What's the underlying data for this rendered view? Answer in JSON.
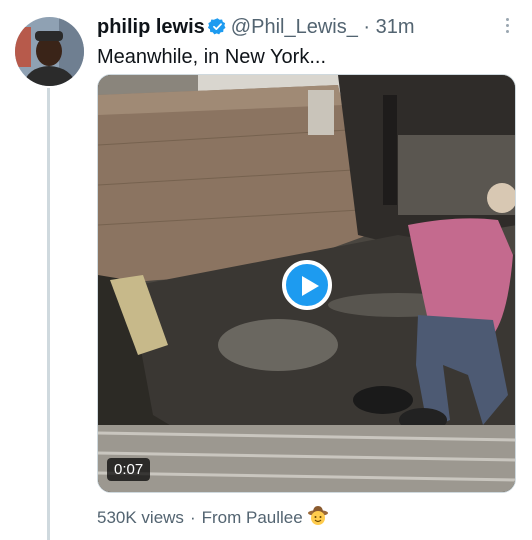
{
  "tweet": {
    "author": {
      "display_name": "philip lewis",
      "handle": "@Phil_Lewis_",
      "verified_icon": "verified-badge-icon",
      "avatar_icon": "avatar-photo"
    },
    "separator": "·",
    "time": "31m",
    "more_icon": "more-options-icon",
    "text": "Meanwhile, in New York...",
    "media": {
      "kind": "video",
      "play_icon": "play-icon",
      "duration": "0:07",
      "accent_color": "#1d9bf0"
    },
    "footer": {
      "views": "530K views",
      "separator": "·",
      "source": "From Paullee",
      "emoji": "cowboy-emoji"
    }
  }
}
